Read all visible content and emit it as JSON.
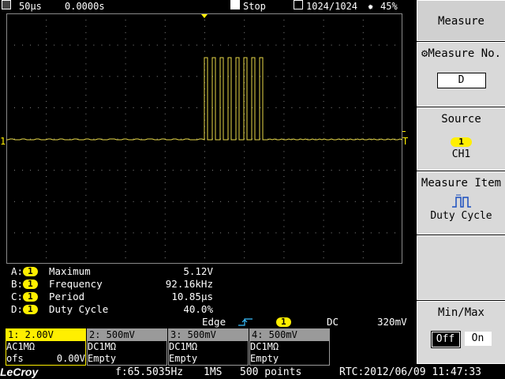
{
  "topbar": {
    "timebase": "50µs",
    "delay": "0.0000s",
    "run_state": "Stop",
    "acquisition": "1024/1024",
    "brightness": "45%"
  },
  "screen": {
    "trigger_marker": "T",
    "channel_marker": "1"
  },
  "measurements": [
    {
      "letter": "A:",
      "channel": "1",
      "name": "Maximum",
      "value": "5.12V"
    },
    {
      "letter": "B:",
      "channel": "1",
      "name": "Frequency",
      "value": "92.16kHz"
    },
    {
      "letter": "C:",
      "channel": "1",
      "name": "Period",
      "value": "10.85µs"
    },
    {
      "letter": "D:",
      "channel": "1",
      "name": "Duty Cycle",
      "value": "40.0%"
    }
  ],
  "trigger": {
    "mode": "Edge",
    "channel": "1",
    "coupling": "DC",
    "level": "320mV"
  },
  "channels": [
    {
      "header": "1: 2.00V",
      "coupling": "AC1MΩ",
      "extra_label": "ofs",
      "extra_value": "0.00V",
      "active": true
    },
    {
      "header": "2: 500mV",
      "coupling": "DC1MΩ",
      "extra_label": "Empty",
      "extra_value": "",
      "active": false
    },
    {
      "header": "3: 500mV",
      "coupling": "DC1MΩ",
      "extra_label": "Empty",
      "extra_value": "",
      "active": false
    },
    {
      "header": "4: 500mV",
      "coupling": "DC1MΩ",
      "extra_label": "Empty",
      "extra_value": "",
      "active": false
    }
  ],
  "status": {
    "brand": "LeCroy",
    "frequency": "f:65.5035Hz",
    "sample_rate": "1MS",
    "points": "500 points",
    "rtc": "RTC:2012/06/09 11:47:33"
  },
  "side_menu": {
    "title": "Measure",
    "measure_no_label": "Measure No.",
    "measure_no_value": "D",
    "source_label": "Source",
    "source_channel": "1",
    "source_value": "CH1",
    "item_label": "Measure Item",
    "item_value": "Duty Cycle",
    "minmax_label": "Min/Max",
    "minmax_off": "Off",
    "minmax_on": "On"
  },
  "colors": {
    "trace": "#e8d948",
    "highlight": "#ffef00",
    "grid": "#8a8a8a",
    "panel": "#d9d9d9"
  }
}
